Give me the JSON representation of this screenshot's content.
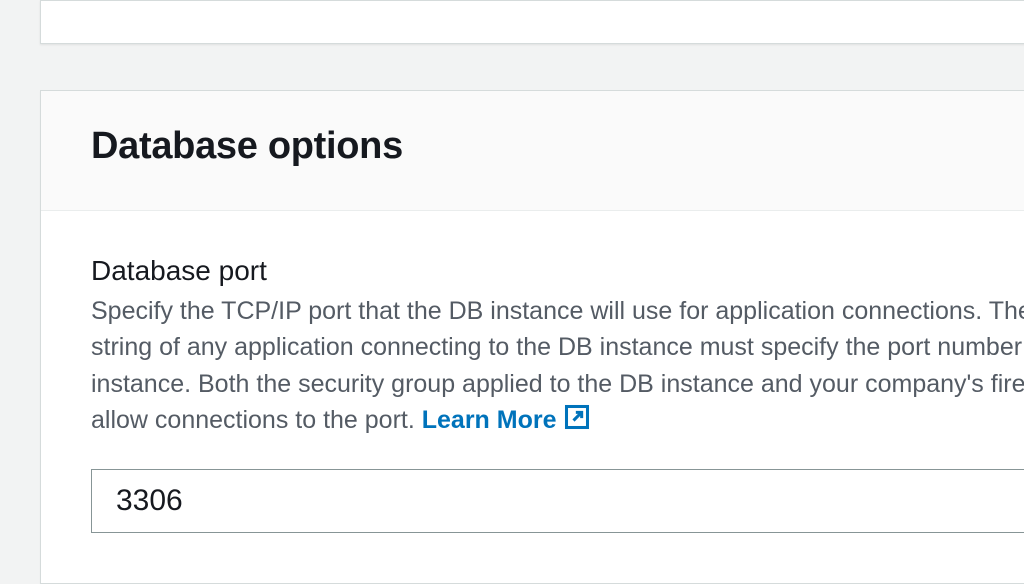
{
  "section": {
    "title": "Database options"
  },
  "field": {
    "label": "Database port",
    "description_part1": "Specify the TCP/IP port that the DB instance will use for application connections. The connection string of any application connecting to the DB instance must specify the port number of the DB instance. Both the security group applied to the DB instance and your company's firewalls must allow connections to the port. ",
    "learn_more": "Learn More",
    "value": "3306"
  }
}
